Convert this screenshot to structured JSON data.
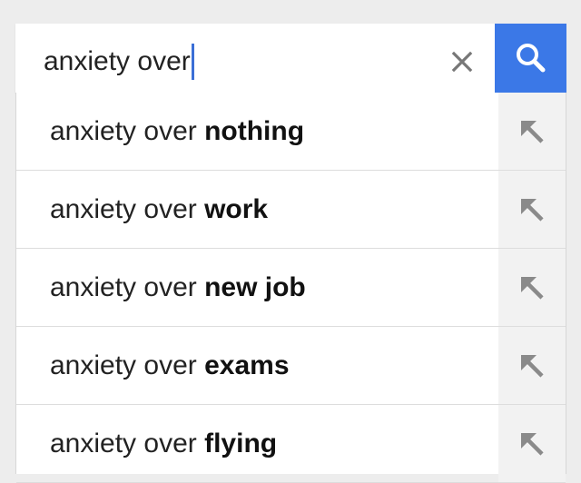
{
  "colors": {
    "accent": "#3b78e7",
    "caret": "#3b6fd6",
    "icon_gray": "#777777",
    "arrow_gray": "#8a8a8a"
  },
  "search": {
    "query": "anxiety over",
    "clear_icon": "close-icon",
    "submit_icon": "search-icon"
  },
  "suggestions": [
    {
      "prefix": "anxiety over ",
      "completion": "nothing",
      "icon": "fill-query-arrow-icon"
    },
    {
      "prefix": "anxiety over ",
      "completion": "work",
      "icon": "fill-query-arrow-icon"
    },
    {
      "prefix": "anxiety over ",
      "completion": "new job",
      "icon": "fill-query-arrow-icon"
    },
    {
      "prefix": "anxiety over ",
      "completion": "exams",
      "icon": "fill-query-arrow-icon"
    },
    {
      "prefix": "anxiety over ",
      "completion": "flying",
      "icon": "fill-query-arrow-icon"
    }
  ]
}
